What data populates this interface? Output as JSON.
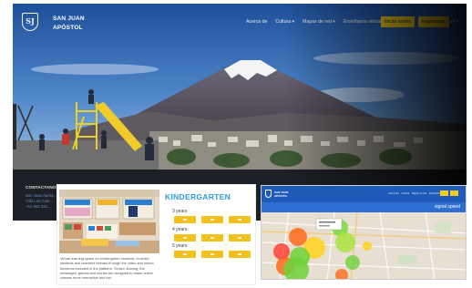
{
  "header": {
    "brand": [
      "SAN JUAN",
      "APÓSTOL"
    ],
    "logo_text": "SJ",
    "nav": [
      "Acerca de",
      "Cultura ▾",
      "Mapas de red ▾",
      "Enseñanza virtual"
    ],
    "login_label": "Iniciar sesión",
    "register_label": "Registrarse",
    "language": "es ▾"
  },
  "footer": {
    "contact_title": "CONTACTANOS",
    "lines": [
      "San Juan Apóst...",
      "Villa Los Com...",
      "+51 950 321..."
    ]
  },
  "kindergarten": {
    "title": "KINDERGARTEN",
    "ages": [
      "3 years",
      "4 years",
      "5 years"
    ],
    "description": "Virtual learning space for kindergarten students, in which students and teachers interact through the video and sound functions included in the platform. Screen sharing, live messages, games and stories are designed to make online classes more interactive and fun.",
    "labels": [
      "Personal Social",
      "Matemática",
      "Comunicación",
      "Ciencia y Ambiente"
    ]
  },
  "map_panel": {
    "brand": [
      "SAN JUAN",
      "APÓSTOL"
    ],
    "nav": [
      "Acerca de",
      "Cultura",
      "Mapas de red",
      "Enseñanza virtual"
    ],
    "title": "signal speed"
  },
  "colors": {
    "accent_yellow": "#f4cc1c",
    "kg_title_blue": "#2d9de6",
    "map_header_blue": "#1f5cba"
  }
}
